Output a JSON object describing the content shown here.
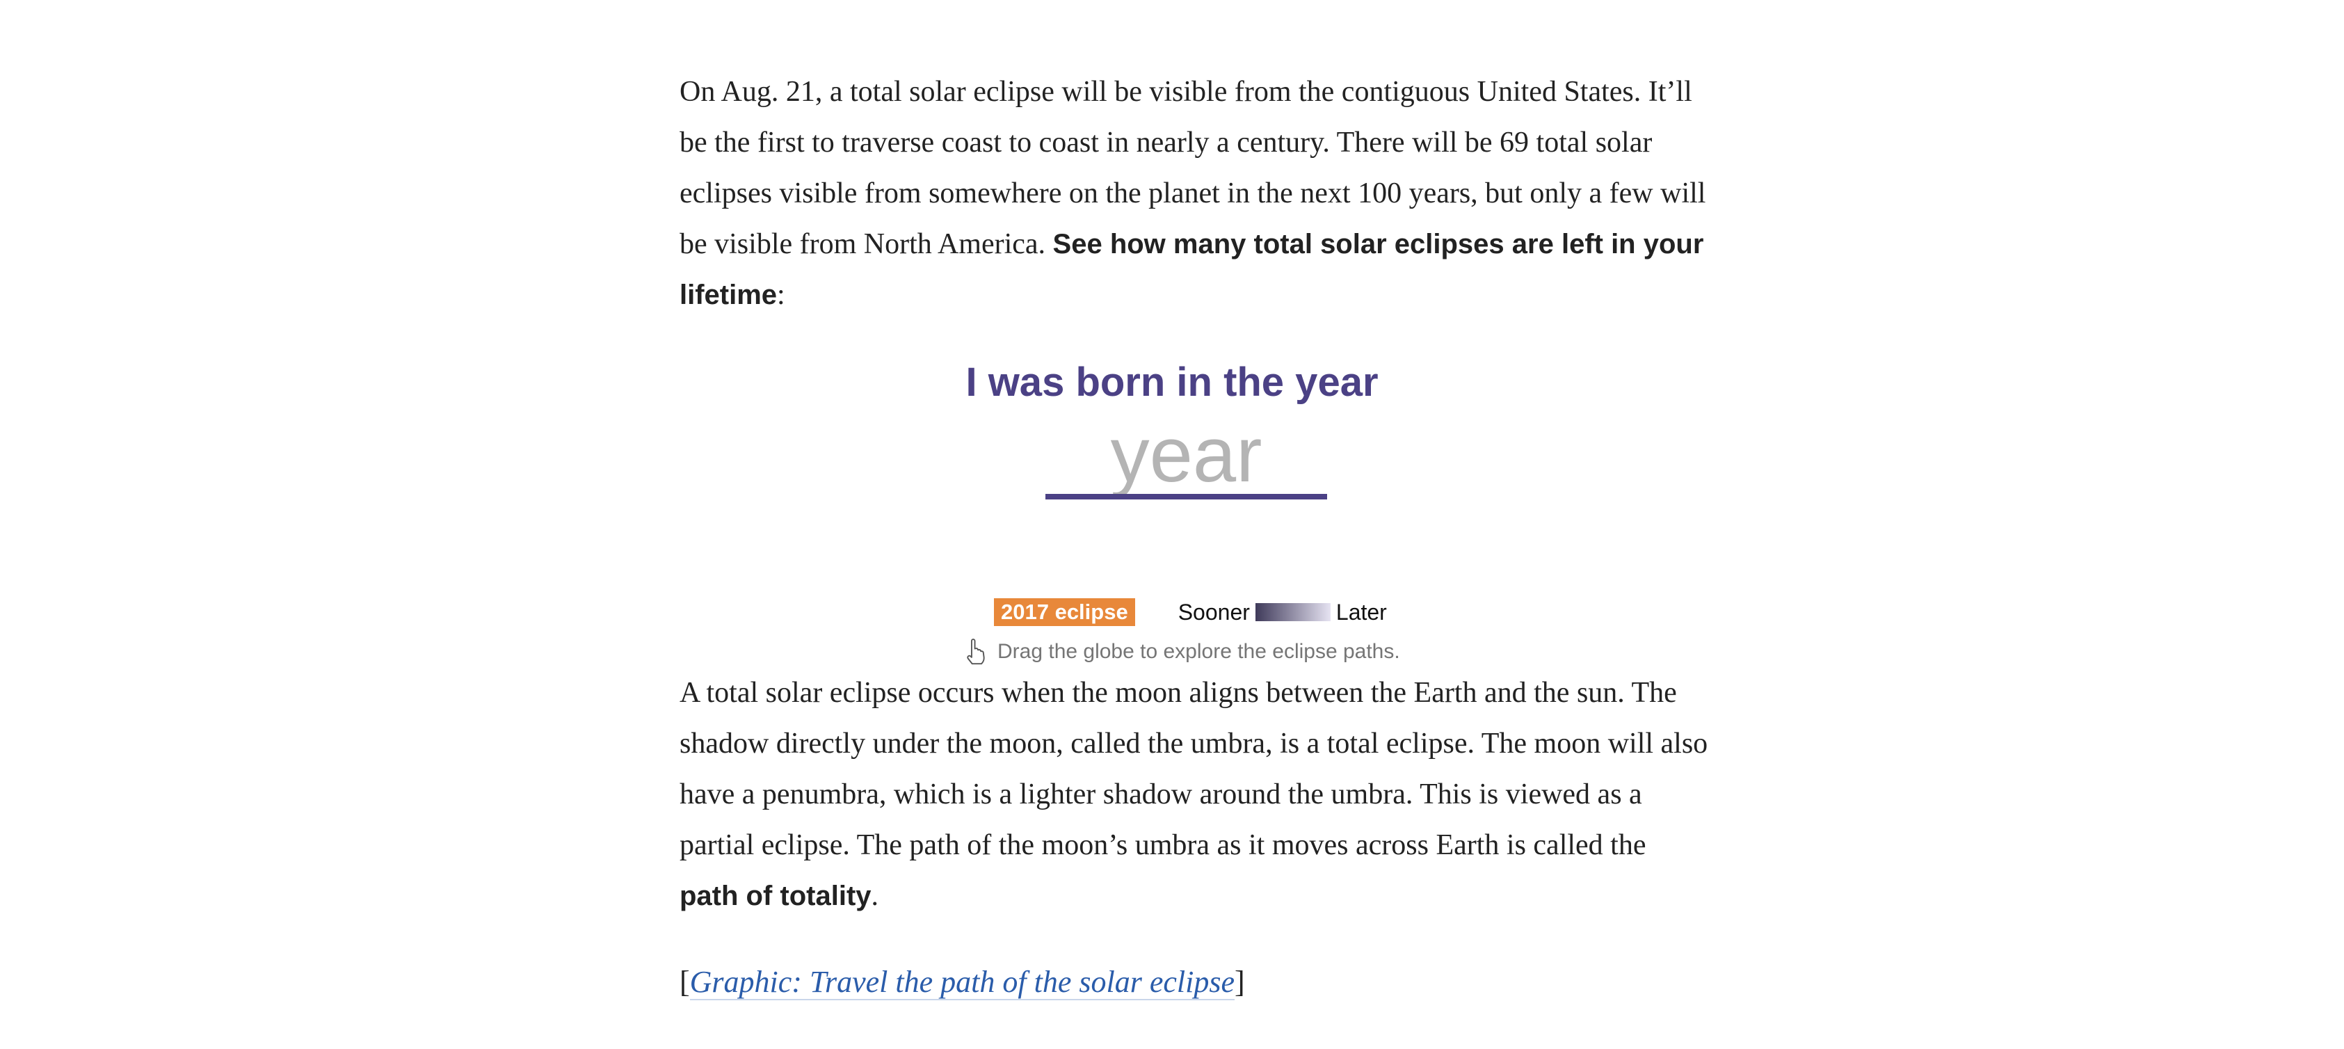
{
  "intro": {
    "text": "On Aug. 21, a total solar eclipse will be visible from the contiguous United States. It’ll be the first to traverse coast to coast in nearly a century. There will be 69 total solar eclipses visible from somewhere on the planet in the next 100 years, but only a few will be visible from North America. ",
    "bold": "See how many total solar eclipses are left in your lifetime",
    "tail": ":"
  },
  "birth_year": {
    "heading": "I was born in the year",
    "placeholder": "year",
    "value": ""
  },
  "legend": {
    "badge": "2017 eclipse",
    "badge_color": "#e8883a",
    "sooner_label": "Sooner",
    "later_label": "Later",
    "gradient_start": "#3f3a5a",
    "gradient_end": "#e6e3f2"
  },
  "hint": {
    "icon": "hand-pointer-icon",
    "text": "Drag the globe to explore the eclipse paths."
  },
  "explain": {
    "text": "A total solar eclipse occurs when the moon aligns between the Earth and the sun. The shadow directly under the moon, called the umbra, is a total eclipse. The moon will also have a penumbra, which is a lighter shadow around the umbra. This is viewed as a partial eclipse. The path of the moon’s umbra as it moves across Earth is called the ",
    "bold": "path of totality",
    "tail": "."
  },
  "related": {
    "open": "[",
    "link_text": "Graphic: Travel the path of the solar eclipse",
    "close": "]"
  },
  "colors": {
    "accent": "#4b4185",
    "link": "#2a5caa"
  }
}
